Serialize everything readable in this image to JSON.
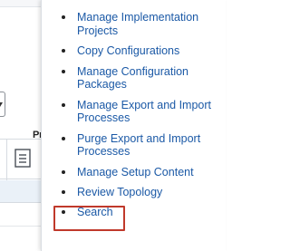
{
  "background": {
    "column_header": "Pr"
  },
  "menu": {
    "items": [
      {
        "label": "Manage Implementation Projects"
      },
      {
        "label": "Copy Configurations"
      },
      {
        "label": "Manage Configuration Packages"
      },
      {
        "label": "Manage Export and Import Processes"
      },
      {
        "label": "Purge Export and Import Processes"
      },
      {
        "label": "Manage Setup Content"
      },
      {
        "label": "Review Topology"
      },
      {
        "label": "Search"
      }
    ],
    "highlighted_item": "Search",
    "link_color": "#1b59a6",
    "highlight_color": "#c0392b"
  },
  "icons": {
    "dropdown": "chevron-down-icon",
    "row_action": "document-icon"
  }
}
